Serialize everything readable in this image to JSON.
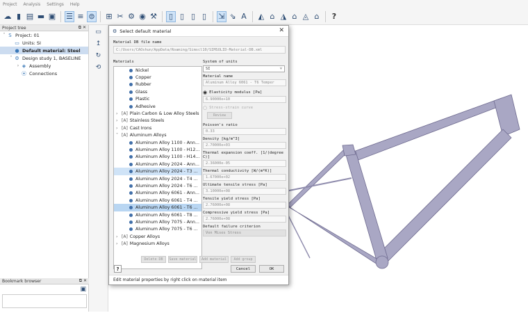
{
  "menu": [
    "Project",
    "Analysis",
    "Settings",
    "Help"
  ],
  "toolbar_icons": [
    "cloud-icon",
    "new-file-icon",
    "save-icon",
    "open-folder-icon",
    "save-as-icon",
    "tree-view-icon",
    "list-view-icon",
    "material-db-icon",
    "mesh-icon",
    "cross-section-icon",
    "solver-icon",
    "visibility-icon",
    "settings-icon",
    "probe-icon",
    "probe2-icon",
    "probe3-icon",
    "probe4-icon",
    "measure-icon",
    "measure2-icon",
    "text-label-icon",
    "chart-icon",
    "chart2-icon",
    "chart3-icon",
    "chart4-icon",
    "chart5-icon",
    "chart6-icon",
    "help-icon"
  ],
  "project_tree": {
    "header": "Project tree",
    "items": [
      {
        "label": "Project: 01",
        "level": 0,
        "arrow": "˅",
        "icon": "S",
        "icon_name": "project-icon"
      },
      {
        "label": "Units: SI",
        "level": 1,
        "arrow": "",
        "icon": "▭",
        "icon_name": "units-icon"
      },
      {
        "label": "Default material: Steel",
        "level": 1,
        "arrow": "",
        "icon": "●",
        "icon_name": "material-icon",
        "selected": true
      },
      {
        "label": "Design study 1, BASELINE",
        "level": 1,
        "arrow": "˅",
        "icon": "⚙",
        "icon_name": "study-icon"
      },
      {
        "label": "Assembly",
        "level": 2,
        "arrow": "›",
        "icon": "◈",
        "icon_name": "assembly-icon"
      },
      {
        "label": "Connections",
        "level": 2,
        "arrow": "",
        "icon": "⦿",
        "icon_name": "connections-icon"
      }
    ]
  },
  "bookmark": {
    "header": "Bookmark browser"
  },
  "dialog": {
    "title": "Select default material",
    "db_label": "Material DB file name",
    "db_path": "C:/Users/CAOshun/AppData/Roaming/Simscl10/SIMSOLID-Material-DB.xml",
    "materials_label": "Materials",
    "units_label": "System of units",
    "units_value": "SI",
    "material_name_label": "Material name",
    "material_name": "Aluminum Alloy 6061 - T6 Temper",
    "elastic_label": "Elasticity modulus [Pa]",
    "elastic_value": "6.90000e+10",
    "stress_strain_label": "Stress-strain curve",
    "review_label": "Review",
    "poisson_label": "Poisson's ratio",
    "poisson_value": "0.33",
    "density_label": "Density [kg/m^3]",
    "density_value": "2.70000e+03",
    "thermal_exp_label": "Thermal expansion coeff. [1/(degree C)]",
    "thermal_exp_value": "2.36000e-05",
    "thermal_cond_label": "Thermal conductivity [W/(m*K)]",
    "thermal_cond_value": "1.67000e+02",
    "uts_label": "Ultimate tensile stress [Pa]",
    "uts_value": "3.10000e+08",
    "tys_label": "Tensile yield stress [Pa]",
    "tys_value": "2.76000e+08",
    "cys_label": "Compressive yield stress [Pa]",
    "cys_value": "2.76000e+08",
    "failure_label": "Default failure criterion",
    "failure_value": "Von Mises Stress",
    "buttons": [
      "Delete DB",
      "Save material",
      "Add material",
      "Add group"
    ],
    "cancel": "Cancel",
    "ok": "OK",
    "help": "?",
    "status": "Edit material properties by right click on material item",
    "materials": [
      {
        "label": "Nickel",
        "type": "item"
      },
      {
        "label": "Copper",
        "type": "item"
      },
      {
        "label": "Rubber",
        "type": "item"
      },
      {
        "label": "Glass",
        "type": "item"
      },
      {
        "label": "Plastic",
        "type": "item"
      },
      {
        "label": "Adhesive",
        "type": "item"
      },
      {
        "label": "Plain Carbon & Low Alloy Steels",
        "type": "group",
        "arrow": "›"
      },
      {
        "label": "Stainless Steels",
        "type": "group",
        "arrow": "›"
      },
      {
        "label": "Cast Irons",
        "type": "group",
        "arrow": "›"
      },
      {
        "label": "Aluminum Alloys",
        "type": "group",
        "arrow": "˅"
      },
      {
        "label": "Aluminum Alloy 1100 - Ann...",
        "type": "item"
      },
      {
        "label": "Aluminum Alloy 1100 - H12...",
        "type": "item"
      },
      {
        "label": "Aluminum Alloy 1100 - H14...",
        "type": "item"
      },
      {
        "label": "Aluminum Alloy 2024 - Ann...",
        "type": "item"
      },
      {
        "label": "Aluminum Alloy 2024 - T3 ...",
        "type": "item",
        "highlight": true
      },
      {
        "label": "Aluminum Alloy 2024 - T4 ...",
        "type": "item"
      },
      {
        "label": "Aluminum Alloy 2024 - T6 ...",
        "type": "item"
      },
      {
        "label": "Aluminum Alloy 6061 - Ann...",
        "type": "item"
      },
      {
        "label": "Aluminum Alloy 6061 - T4 ...",
        "type": "item"
      },
      {
        "label": "Aluminum Alloy 6061 - T6 ...",
        "type": "item",
        "selected": true
      },
      {
        "label": "Aluminum Alloy 6061 - T8 ...",
        "type": "item"
      },
      {
        "label": "Aluminum Alloy 7075 - Ann...",
        "type": "item"
      },
      {
        "label": "Aluminum Alloy 7075 - T6 ...",
        "type": "item"
      },
      {
        "label": "Copper Alloys",
        "type": "group",
        "arrow": "›"
      },
      {
        "label": "Magnesium Alloys",
        "type": "group",
        "arrow": "›"
      }
    ]
  },
  "colors": {
    "frame": "#a9a7c4",
    "frame_edge": "#6e6a8f",
    "selection": "#cfe3f7",
    "icon": "#2d4c73"
  }
}
